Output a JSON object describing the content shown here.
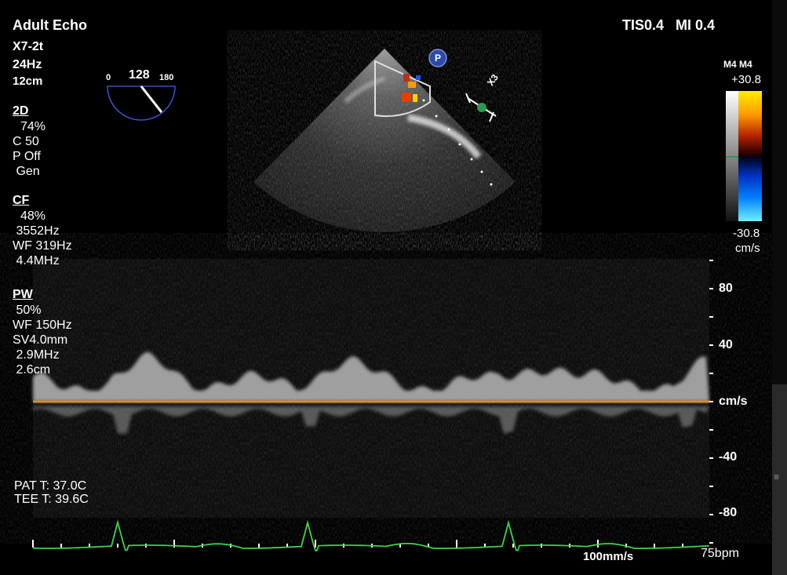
{
  "header": {
    "mode": "Adult Echo",
    "probe": "X7-2t",
    "frame_rate": "24Hz",
    "depth": "12cm",
    "tis_mi": "TIS0.4   MI 0.4"
  },
  "probe_angle": {
    "min": "0",
    "value": "128",
    "max": "180",
    "angle_deg": 128
  },
  "sections": {
    "twoD": {
      "title": "2D",
      "lines": [
        "74%",
        "C 50",
        "P Off",
        " Gen"
      ]
    },
    "cf": {
      "title": "CF",
      "lines": [
        "48%",
        " 3552Hz",
        "WF 319Hz",
        " 4.4MHz"
      ]
    },
    "pw": {
      "title": "PW",
      "lines": [
        " 50%",
        "WF 150Hz",
        "SV4.0mm",
        " 2.9MHz",
        " 2.6cm"
      ]
    }
  },
  "temperatures": {
    "pat": "PAT T: 37.0C",
    "tee": "TEE T: 39.6C"
  },
  "color_bar": {
    "map": "M4 M4",
    "max": "+30.8",
    "min": "-30.8",
    "unit": "cm/s",
    "colors": [
      "#ffffff",
      "#ffd000",
      "#d04000",
      "#3a0000",
      "#000000",
      "#001040",
      "#0050ff",
      "#60e0ff"
    ]
  },
  "doppler_scale": {
    "ticks": [
      "80",
      "40",
      "cm/s",
      "-40",
      "-80"
    ],
    "values": [
      80,
      40,
      0,
      -40,
      -80
    ]
  },
  "ecg": {
    "sweep": "100mm/s",
    "heart_rate": "75bpm",
    "color": "#3fd24a"
  },
  "markers": {
    "p_label": "P",
    "focus_label": "X3"
  },
  "colors": {
    "baseline": "#d98a2a",
    "background": "#000000",
    "text": "#ffffff"
  }
}
